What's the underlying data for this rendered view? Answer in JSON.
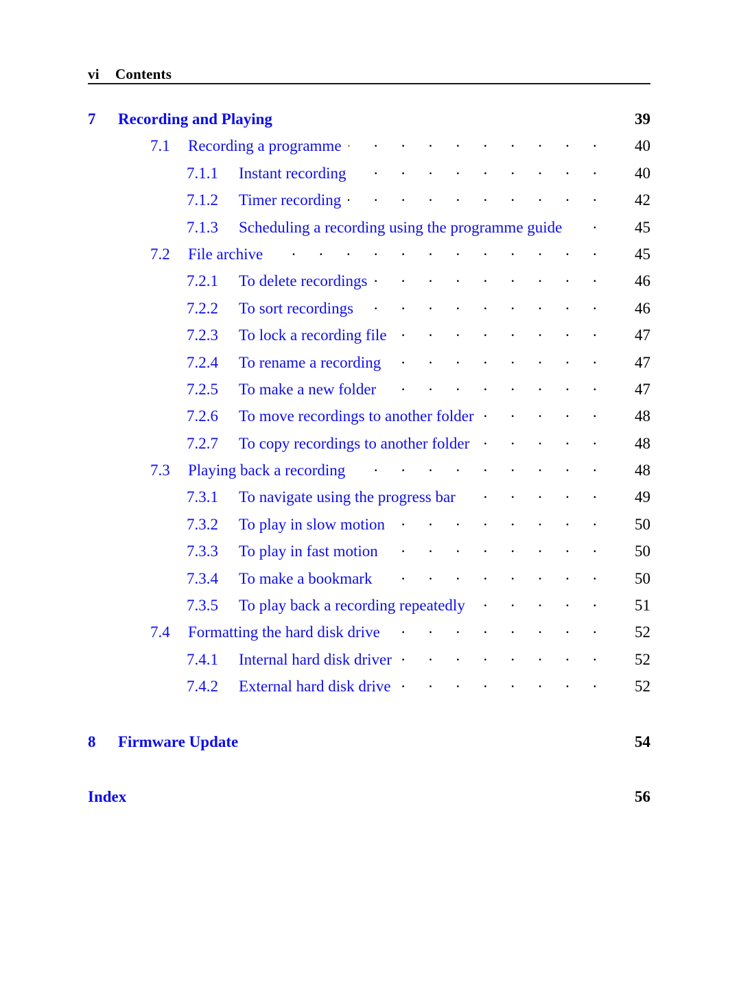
{
  "page": {
    "folio": "vi",
    "running_title": "Contents",
    "background_color": "#ffffff",
    "link_color": "#0d0de8",
    "text_color": "#000000"
  },
  "toc": {
    "entries": [
      {
        "level": "chapter",
        "number": "7",
        "title": "Recording and Playing",
        "page": "39",
        "leaders": false,
        "gap_before": false
      },
      {
        "level": "section",
        "number": "7.1",
        "title": "Recording a programme",
        "page": "40",
        "leaders": true,
        "gap_before": false
      },
      {
        "level": "subsection",
        "number": "7.1.1",
        "title": "Instant recording",
        "page": "40",
        "leaders": true,
        "gap_before": false
      },
      {
        "level": "subsection",
        "number": "7.1.2",
        "title": "Timer recording",
        "page": "42",
        "leaders": true,
        "gap_before": false
      },
      {
        "level": "subsection",
        "number": "7.1.3",
        "title": "Scheduling a recording using the programme guide",
        "page": "45",
        "leaders": true,
        "gap_before": false
      },
      {
        "level": "section",
        "number": "7.2",
        "title": "File archive",
        "page": "45",
        "leaders": true,
        "gap_before": false
      },
      {
        "level": "subsection",
        "number": "7.2.1",
        "title": "To delete recordings",
        "page": "46",
        "leaders": true,
        "gap_before": false
      },
      {
        "level": "subsection",
        "number": "7.2.2",
        "title": "To sort recordings",
        "page": "46",
        "leaders": true,
        "gap_before": false
      },
      {
        "level": "subsection",
        "number": "7.2.3",
        "title": "To lock a recording file",
        "page": "47",
        "leaders": true,
        "gap_before": false
      },
      {
        "level": "subsection",
        "number": "7.2.4",
        "title": "To rename a recording",
        "page": "47",
        "leaders": true,
        "gap_before": false
      },
      {
        "level": "subsection",
        "number": "7.2.5",
        "title": "To make a new folder",
        "page": "47",
        "leaders": true,
        "gap_before": false
      },
      {
        "level": "subsection",
        "number": "7.2.6",
        "title": "To move recordings to another folder",
        "page": "48",
        "leaders": true,
        "gap_before": false
      },
      {
        "level": "subsection",
        "number": "7.2.7",
        "title": "To copy recordings to another folder",
        "page": "48",
        "leaders": true,
        "gap_before": false
      },
      {
        "level": "section",
        "number": "7.3",
        "title": "Playing back a recording",
        "page": "48",
        "leaders": true,
        "gap_before": false
      },
      {
        "level": "subsection",
        "number": "7.3.1",
        "title": "To navigate using the progress bar",
        "page": "49",
        "leaders": true,
        "gap_before": false
      },
      {
        "level": "subsection",
        "number": "7.3.2",
        "title": "To play in slow motion",
        "page": "50",
        "leaders": true,
        "gap_before": false
      },
      {
        "level": "subsection",
        "number": "7.3.3",
        "title": "To play in fast motion",
        "page": "50",
        "leaders": true,
        "gap_before": false
      },
      {
        "level": "subsection",
        "number": "7.3.4",
        "title": "To make a bookmark",
        "page": "50",
        "leaders": true,
        "gap_before": false
      },
      {
        "level": "subsection",
        "number": "7.3.5",
        "title": "To play back a recording repeatedly",
        "page": "51",
        "leaders": true,
        "gap_before": false
      },
      {
        "level": "section",
        "number": "7.4",
        "title": "Formatting the hard disk drive",
        "page": "52",
        "leaders": true,
        "gap_before": false
      },
      {
        "level": "subsection",
        "number": "7.4.1",
        "title": "Internal hard disk driver",
        "page": "52",
        "leaders": true,
        "gap_before": false
      },
      {
        "level": "subsection",
        "number": "7.4.2",
        "title": "External hard disk drive",
        "page": "52",
        "leaders": true,
        "gap_before": false
      },
      {
        "level": "chapter",
        "number": "8",
        "title": "Firmware Update",
        "page": "54",
        "leaders": false,
        "gap_before": true
      },
      {
        "level": "chapter",
        "number": "",
        "title": "Index",
        "page": "56",
        "leaders": false,
        "gap_before": true
      }
    ]
  }
}
